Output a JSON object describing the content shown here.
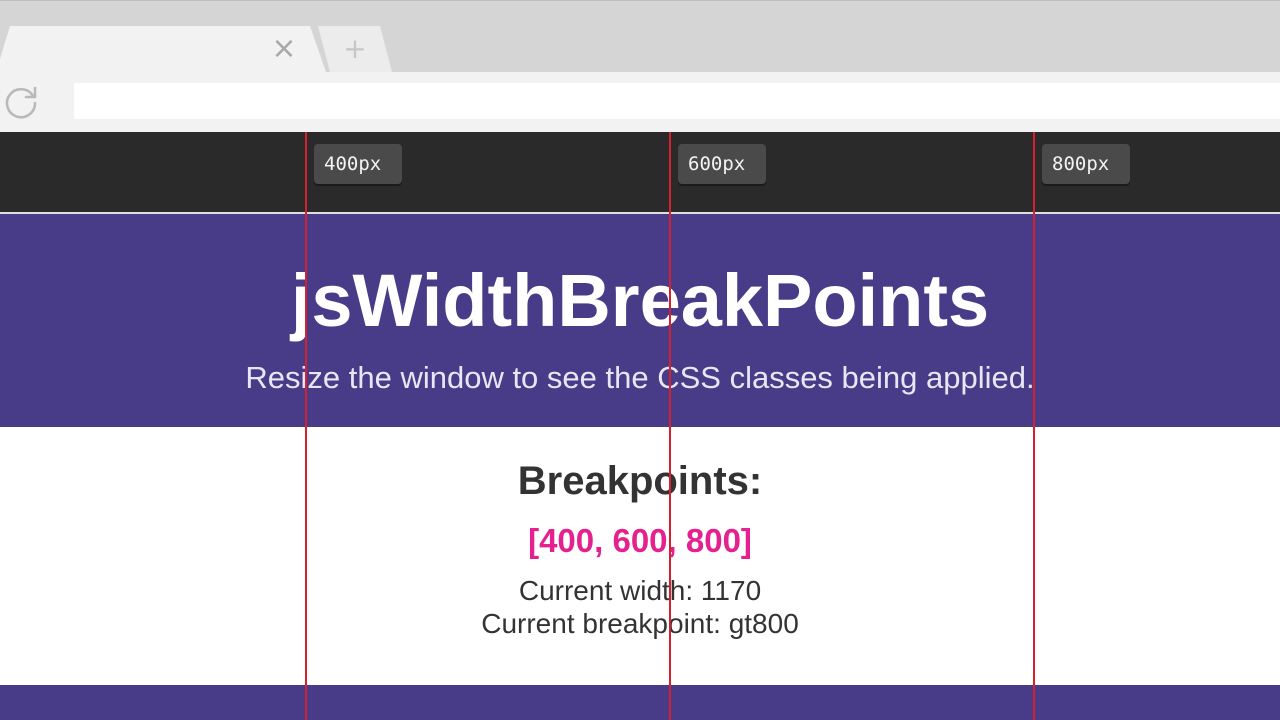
{
  "browser": {
    "tab_close_glyph": "×",
    "new_tab_glyph": "+",
    "reload_icon": "reload-icon",
    "address_value": ""
  },
  "ruler": {
    "breakpoint_badges": [
      "400px",
      "600px",
      "800px"
    ]
  },
  "header": {
    "title": "jsWidthBreakPoints",
    "subtitle": "Resize the window to see the CSS classes being applied."
  },
  "content": {
    "heading": "Breakpoints:",
    "breakpoints_list": "[400, 600, 800]",
    "current_width": "Current width: 1170",
    "current_breakpoint": "Current breakpoint: gt800"
  },
  "colors": {
    "header_bg": "#483b88",
    "ruler_bg": "#2a2a2a",
    "accent_pink": "#e4218e",
    "guide_line": "#d4202f"
  }
}
